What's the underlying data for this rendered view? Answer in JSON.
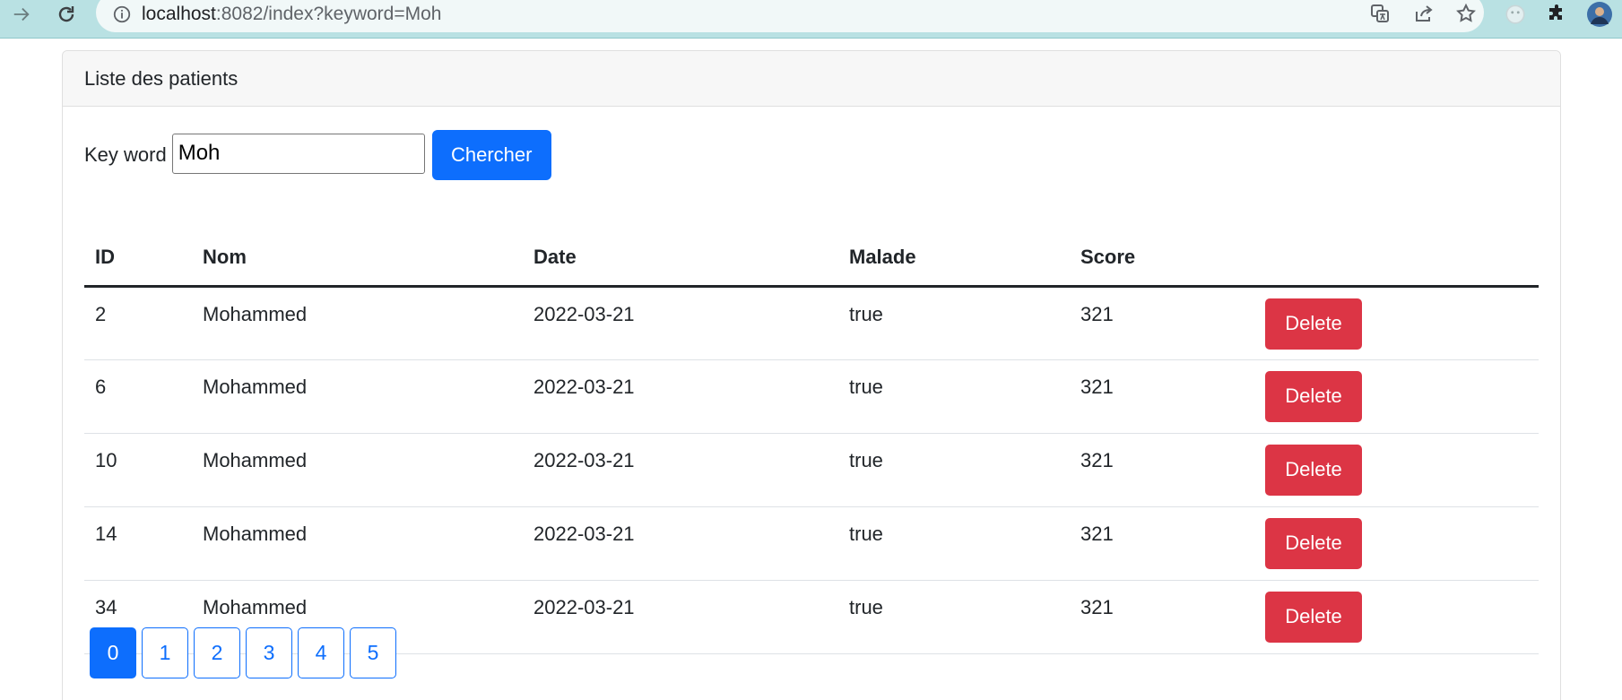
{
  "browser": {
    "url_host": "localhost",
    "url_rest": ":8082/index?keyword=Moh"
  },
  "card": {
    "header_title": "Liste des patients"
  },
  "search": {
    "label": "Key word",
    "value": "Moh",
    "button_label": "Chercher"
  },
  "table": {
    "headers": [
      "ID",
      "Nom",
      "Date",
      "Malade",
      "Score",
      ""
    ],
    "delete_label": "Delete",
    "rows": [
      {
        "id": "2",
        "nom": "Mohammed",
        "date": "2022-03-21",
        "malade": "true",
        "score": "321"
      },
      {
        "id": "6",
        "nom": "Mohammed",
        "date": "2022-03-21",
        "malade": "true",
        "score": "321"
      },
      {
        "id": "10",
        "nom": "Mohammed",
        "date": "2022-03-21",
        "malade": "true",
        "score": "321"
      },
      {
        "id": "14",
        "nom": "Mohammed",
        "date": "2022-03-21",
        "malade": "true",
        "score": "321"
      },
      {
        "id": "34",
        "nom": "Mohammed",
        "date": "2022-03-21",
        "malade": "true",
        "score": "321"
      }
    ]
  },
  "pagination": {
    "pages": [
      "0",
      "1",
      "2",
      "3",
      "4",
      "5"
    ],
    "active": "0"
  },
  "colors": {
    "primary": "#0d6efd",
    "danger": "#dc3545",
    "browser_bar": "#b9e1e3"
  },
  "icons": {
    "forward": "arrow-right-icon",
    "reload": "reload-icon",
    "site_info": "info-icon",
    "translate": "translate-icon",
    "share": "share-icon",
    "bookmark": "star-icon",
    "extension_a": "extension-icon",
    "extensions": "puzzle-icon",
    "profile": "avatar"
  }
}
